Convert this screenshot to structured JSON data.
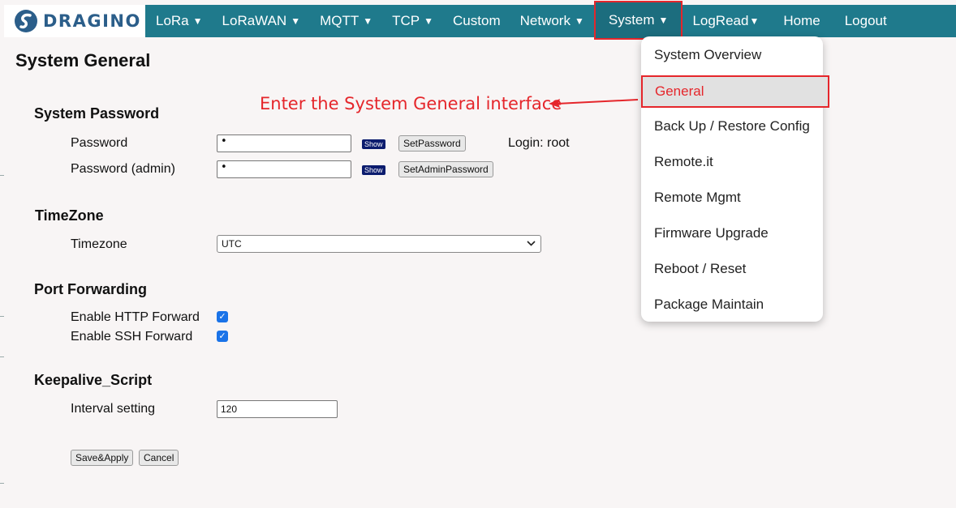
{
  "navbar": {
    "logo_text": "DRAGINO",
    "items": [
      {
        "label": "LoRa",
        "has_caret": true
      },
      {
        "label": "LoRaWAN",
        "has_caret": true
      },
      {
        "label": "MQTT",
        "has_caret": true
      },
      {
        "label": "TCP",
        "has_caret": true
      },
      {
        "label": "Custom",
        "has_caret": false
      },
      {
        "label": "Network",
        "has_caret": true
      },
      {
        "label": "System",
        "has_caret": true
      },
      {
        "label": "LogRead",
        "has_caret": true
      },
      {
        "label": "Home",
        "has_caret": false
      },
      {
        "label": "Logout",
        "has_caret": false
      }
    ],
    "caret_glyph": "▼"
  },
  "page": {
    "title": "System General"
  },
  "password_section": {
    "title": "System Password",
    "password_label": "Password",
    "password_value": "•",
    "show_label": "Show",
    "set_password_label": "SetPassword",
    "login_text": "Login: root",
    "admin_label": "Password (admin)",
    "admin_value": "•",
    "set_admin_label": "SetAdminPassword"
  },
  "timezone_section": {
    "title": "TimeZone",
    "label": "Timezone",
    "selected": "UTC",
    "chevron": "⌄"
  },
  "port_section": {
    "title": "Port Forwarding",
    "http_label": "Enable HTTP Forward",
    "http_checked": true,
    "ssh_label": "Enable SSH Forward",
    "ssh_checked": true,
    "check_glyph": "✓"
  },
  "keepalive_section": {
    "title": "Keepalive_Script",
    "interval_label": "Interval setting",
    "interval_value": "120"
  },
  "actions": {
    "save_label": "Save&Apply",
    "cancel_label": "Cancel"
  },
  "system_menu": {
    "items": [
      {
        "label": "System Overview"
      },
      {
        "label": "General"
      },
      {
        "label": "Back Up / Restore Config"
      },
      {
        "label": "Remote.it"
      },
      {
        "label": "Remote Mgmt"
      },
      {
        "label": "Firmware Upgrade"
      },
      {
        "label": "Reboot / Reset"
      },
      {
        "label": "Package Maintain"
      }
    ]
  },
  "annotation": {
    "text": "Enter the System General interface"
  },
  "colors": {
    "navbar_bg": "#1f7a8c",
    "highlight_red": "#e5262b",
    "checkbox_blue": "#1a73e8",
    "show_button_bg": "#0c1c6e"
  }
}
